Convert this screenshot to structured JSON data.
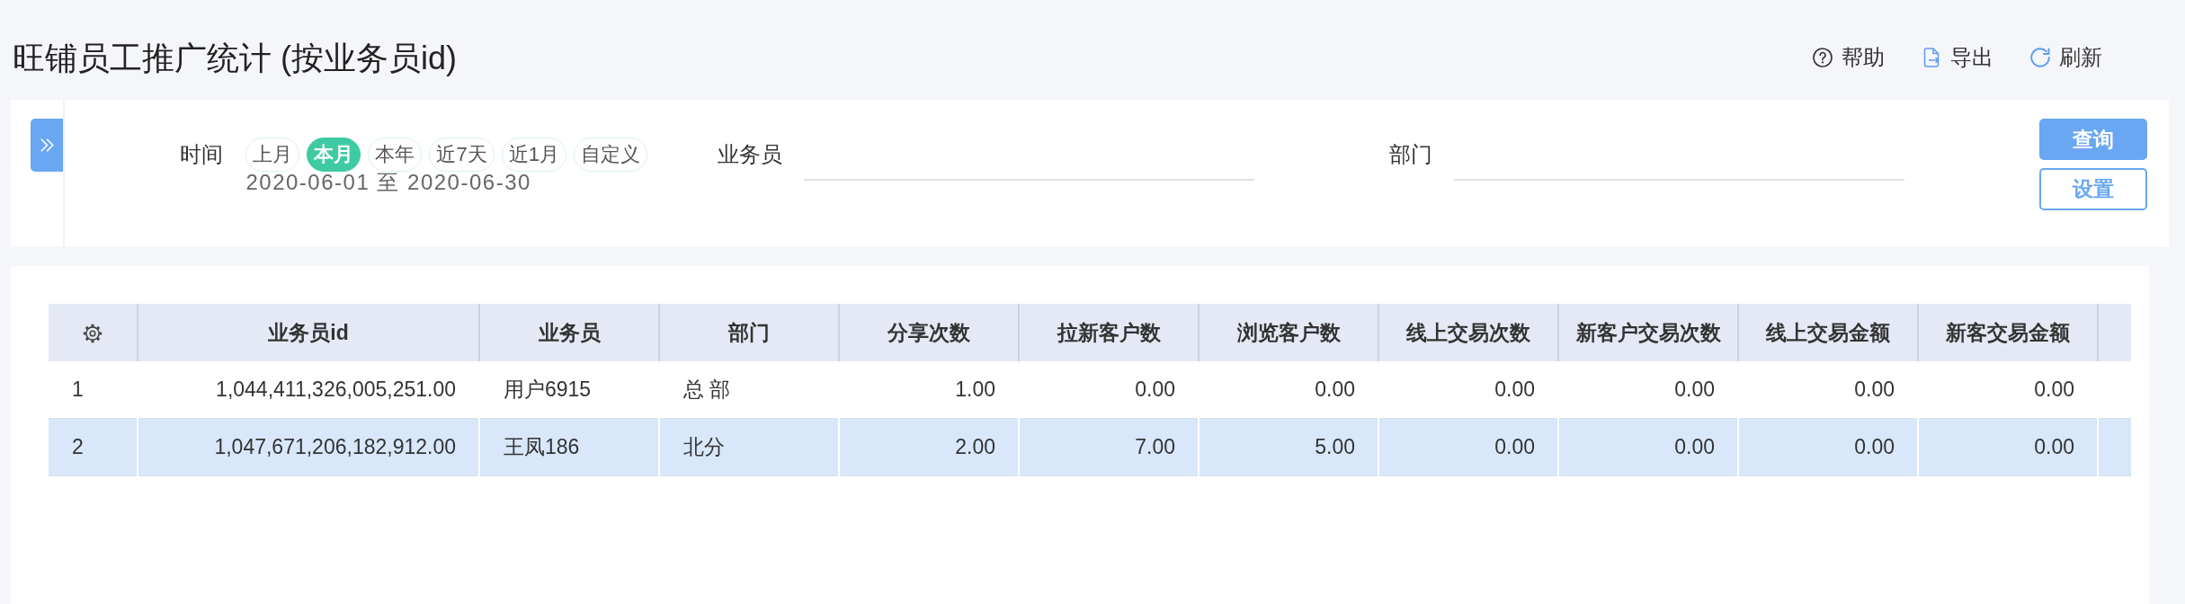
{
  "page": {
    "title": "旺铺员工推广统计 (按业务员id)"
  },
  "toolbar": [
    {
      "kind": "help",
      "label": "帮助"
    },
    {
      "kind": "export",
      "label": "导出"
    },
    {
      "kind": "refresh",
      "label": "刷新"
    }
  ],
  "filters": {
    "time": {
      "label": "时间",
      "presets": [
        {
          "label": "上月",
          "selected": false
        },
        {
          "label": "本月",
          "selected": true
        },
        {
          "label": "本年",
          "selected": false
        },
        {
          "label": "近7天",
          "selected": false
        },
        {
          "label": "近1月",
          "selected": false
        },
        {
          "label": "自定义",
          "selected": false
        }
      ],
      "range": "2020-06-01 至 2020-06-30"
    },
    "fields": [
      {
        "label": "业务员"
      },
      {
        "label": "部门"
      }
    ],
    "buttons": [
      {
        "kind": "query",
        "label": "查询"
      },
      {
        "kind": "settings",
        "label": "设置"
      }
    ]
  },
  "table": {
    "columns": [
      {
        "kind": "index"
      },
      {
        "kind": "number",
        "label": "业务员id"
      },
      {
        "kind": "text",
        "label": "业务员"
      },
      {
        "kind": "text",
        "label": "部门"
      },
      {
        "kind": "number",
        "label": "分享次数"
      },
      {
        "kind": "number",
        "label": "拉新客户数"
      },
      {
        "kind": "number",
        "label": "浏览客户数"
      },
      {
        "kind": "number",
        "label": "线上交易次数"
      },
      {
        "kind": "number",
        "label": "新客户交易次数"
      },
      {
        "kind": "number",
        "label": "线上交易金额"
      },
      {
        "kind": "number",
        "label": "新客交易金额"
      }
    ],
    "rows": [
      {
        "selected": false,
        "cells": [
          "1",
          "1,044,411,326,005,251.00",
          "用户6915",
          "总 部",
          "1.00",
          "0.00",
          "0.00",
          "0.00",
          "0.00",
          "0.00",
          "0.00"
        ]
      },
      {
        "selected": true,
        "cells": [
          "2",
          "1,047,671,206,182,912.00",
          "王凤186",
          "北分",
          "2.00",
          "7.00",
          "5.00",
          "0.00",
          "0.00",
          "0.00",
          "0.00"
        ]
      }
    ]
  }
}
